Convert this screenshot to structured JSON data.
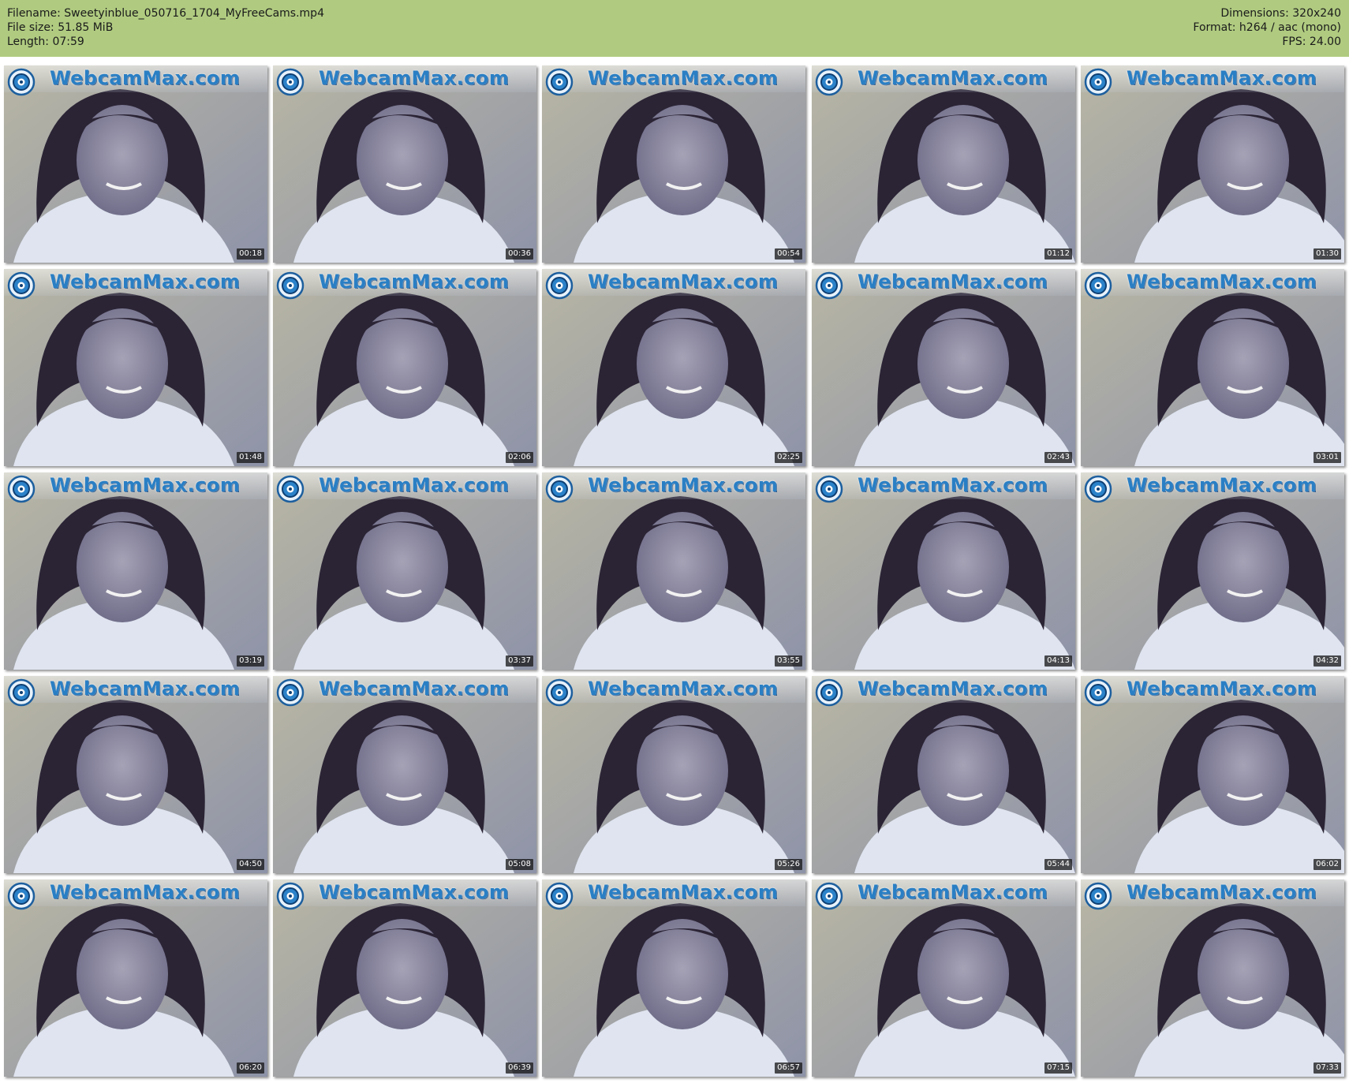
{
  "header": {
    "filename": "Filename: Sweetyinblue_050716_1704_MyFreeCams.mp4",
    "filesize": "File size: 51.85 MiB",
    "length": "Length: 07:59",
    "dimensions": "Dimensions: 320x240",
    "format": "Format: h264 / aac (mono)",
    "fps": "FPS: 24.00"
  },
  "watermark": {
    "text": "WebcamMax.com",
    "icon": "webcam-eye-icon"
  },
  "colors": {
    "header_bg": "#b0cb80",
    "watermark_text": "#2a7fc4",
    "timestamp_bg": "#141414"
  },
  "thumbnails": [
    {
      "timestamp": "00:18"
    },
    {
      "timestamp": "00:36"
    },
    {
      "timestamp": "00:54"
    },
    {
      "timestamp": "01:12"
    },
    {
      "timestamp": "01:30"
    },
    {
      "timestamp": "01:48"
    },
    {
      "timestamp": "02:06"
    },
    {
      "timestamp": "02:25"
    },
    {
      "timestamp": "02:43"
    },
    {
      "timestamp": "03:01"
    },
    {
      "timestamp": "03:19"
    },
    {
      "timestamp": "03:37"
    },
    {
      "timestamp": "03:55"
    },
    {
      "timestamp": "04:13"
    },
    {
      "timestamp": "04:32"
    },
    {
      "timestamp": "04:50"
    },
    {
      "timestamp": "05:08"
    },
    {
      "timestamp": "05:26"
    },
    {
      "timestamp": "05:44"
    },
    {
      "timestamp": "06:02"
    },
    {
      "timestamp": "06:20"
    },
    {
      "timestamp": "06:39"
    },
    {
      "timestamp": "06:57"
    },
    {
      "timestamp": "07:15"
    },
    {
      "timestamp": "07:33"
    }
  ]
}
